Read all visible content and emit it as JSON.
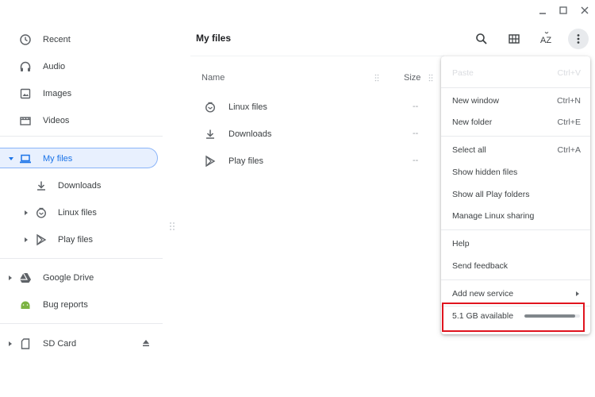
{
  "window": {
    "minimize_glyph": "_",
    "maximize_glyph": "□",
    "close_glyph": "✕"
  },
  "sidebar": {
    "items": [
      {
        "label": "Recent",
        "icon": "clock-icon"
      },
      {
        "label": "Audio",
        "icon": "headphones-icon"
      },
      {
        "label": "Images",
        "icon": "image-icon"
      },
      {
        "label": "Videos",
        "icon": "video-icon"
      },
      {
        "label": "My files",
        "icon": "laptop-icon",
        "selected": true
      },
      {
        "label": "Downloads",
        "icon": "download-icon"
      },
      {
        "label": "Linux files",
        "icon": "linux-icon"
      },
      {
        "label": "Play files",
        "icon": "play-store-icon"
      },
      {
        "label": "Google Drive",
        "icon": "drive-icon"
      },
      {
        "label": "Bug reports",
        "icon": "android-icon"
      },
      {
        "label": "SD Card",
        "icon": "sd-card-icon"
      }
    ]
  },
  "main": {
    "title": "My files",
    "columns": {
      "name": "Name",
      "size": "Size"
    },
    "files": [
      {
        "name": "Linux files",
        "size": "--",
        "icon": "linux-icon"
      },
      {
        "name": "Downloads",
        "size": "--",
        "icon": "download-icon"
      },
      {
        "name": "Play files",
        "size": "--",
        "icon": "play-store-icon"
      }
    ],
    "sort_label": "AZ"
  },
  "menu": {
    "items": [
      {
        "label": "Paste",
        "shortcut": "Ctrl+V",
        "disabled": true
      },
      {
        "label": "New window",
        "shortcut": "Ctrl+N"
      },
      {
        "label": "New folder",
        "shortcut": "Ctrl+E"
      },
      {
        "label": "Select all",
        "shortcut": "Ctrl+A"
      },
      {
        "label": "Show hidden files",
        "shortcut": ""
      },
      {
        "label": "Show all Play folders",
        "shortcut": ""
      },
      {
        "label": "Manage Linux sharing",
        "shortcut": ""
      },
      {
        "label": "Help",
        "shortcut": ""
      },
      {
        "label": "Send feedback",
        "shortcut": ""
      },
      {
        "label": "Add new service",
        "shortcut": ""
      }
    ],
    "storage": {
      "label": "5.1 GB available",
      "used_fraction": 0.92
    }
  },
  "colors": {
    "accent": "#1a73e8",
    "selected_bg": "#e8f0fe",
    "highlight_border": "#e0141e"
  }
}
